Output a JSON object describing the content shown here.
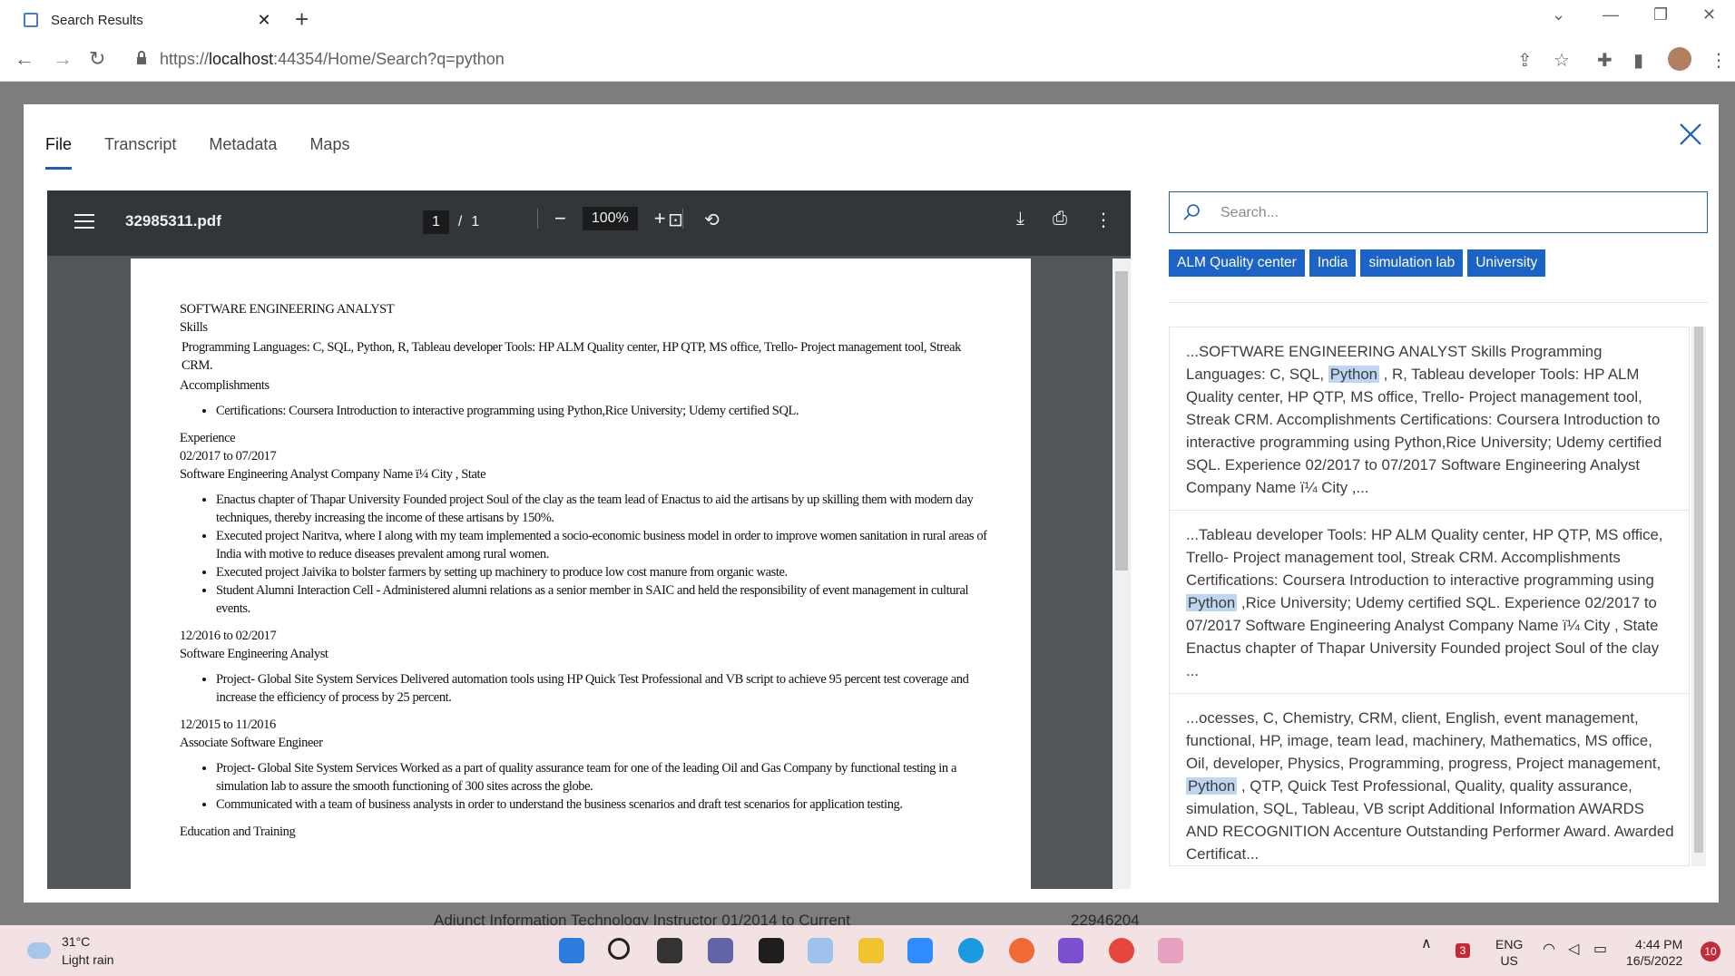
{
  "browser": {
    "tab_title": "Search Results",
    "url_prefix": "https://",
    "url_host": "localhost",
    "url_rest": ":44354/Home/Search?q=python"
  },
  "background_page": {
    "text_left": "Adjunct Information Technology Instructor 01/2014 to Current",
    "text_right": "22946204"
  },
  "modal": {
    "tabs": [
      "File",
      "Transcript",
      "Metadata",
      "Maps"
    ],
    "active_tab": "File"
  },
  "pdf": {
    "filename": "32985311.pdf",
    "current_page": "1",
    "page_sep": "/",
    "total_pages": "1",
    "zoom": "100%",
    "lines": {
      "title": "SOFTWARE ENGINEERING ANALYST",
      "skills": "Skills",
      "skills_text": "Programming Languages: C, SQL, Python, R, Tableau developer Tools: HP ALM Quality center, HP QTP, MS office, Trello- Project management tool, Streak CRM.",
      "accomplishments": "Accomplishments",
      "cert": "Certifications: Coursera Introduction to interactive programming using Python,Rice University; Udemy certified SQL.",
      "experience": "Experience",
      "date1": "02/2017 to 07/2017",
      "role1": "Software Engineering Analyst Company Name ï¼ City , State",
      "b1": "Enactus chapter of Thapar University Founded project Soul of the clay as the team lead of Enactus to aid the artisans by up skilling them with modern day techniques, thereby increasing the income of these artisans by 150%.",
      "b2": "Executed project Naritva, where I along with my team implemented a socio-economic business model in order to improve women sanitation in rural areas of India with motive to reduce diseases prevalent among rural women.",
      "b3": "Executed project Jaivika to bolster farmers by setting up machinery to produce low cost manure from organic waste.",
      "b4": "Student Alumni Interaction Cell - Administered alumni relations as a senior member in SAIC and held the responsibility of event management in cultural events.",
      "date2": "12/2016 to 02/2017",
      "role2": "Software Engineering Analyst",
      "b5": "Project- Global Site System Services Delivered automation tools using HP Quick Test Professional and VB script to achieve 95 percent test coverage and increase the efficiency of process by 25 percent.",
      "date3": "12/2015 to 11/2016",
      "role3": "Associate Software Engineer",
      "b6": "Project- Global Site System Services Worked as a part of quality assurance team for one of the leading Oil and Gas Company by functional testing in a simulation lab to assure the smooth functioning of 300 sites across the globe.",
      "b7": "Communicated with a team of business analysts in order to understand the business scenarios and draft test scenarios for application testing.",
      "edu": "Education and Training"
    }
  },
  "search": {
    "placeholder": "Search..."
  },
  "tags": [
    "ALM Quality center",
    "India",
    "simulation lab",
    "University"
  ],
  "results": [
    {
      "before": "...SOFTWARE ENGINEERING ANALYST Skills Programming Languages: C, SQL, ",
      "highlight": "Python",
      "after": " , R, Tableau developer Tools: HP ALM Quality center, HP QTP, MS office, Trello- Project management tool, Streak CRM. Accomplishments Certifications: Coursera Introduction to interactive programming using Python,Rice University; Udemy certified SQL. Experience 02/2017 to 07/2017 Software Engineering Analyst Company Name ï¼ City ,..."
    },
    {
      "before": "...Tableau developer Tools: HP ALM Quality center, HP QTP, MS office, Trello- Project management tool, Streak CRM. Accomplishments Certifications: Coursera Introduction to interactive programming using ",
      "highlight": "Python",
      "after": " ,Rice University; Udemy certified SQL. Experience 02/2017 to 07/2017 Software Engineering Analyst Company Name ï¼ City , State Enactus chapter of Thapar University Founded project Soul of the clay ..."
    },
    {
      "before": "...ocesses, C, Chemistry, CRM, client, English, event management, functional, HP, image, team lead, machinery, Mathematics, MS office, Oil, developer, Physics, Programming, progress, Project management, ",
      "highlight": "Python",
      "after": " , QTP, Quick Test Professional, Quality, quality assurance, simulation, SQL, Tableau, VB script Additional Information AWARDS AND RECOGNITION Accenture Outstanding Performer Award. Awarded Certificat..."
    }
  ],
  "taskbar": {
    "temperature": "31°C",
    "weather": "Light rain",
    "lang": "ENG",
    "region": "US",
    "time": "4:44 PM",
    "date": "16/5/2022",
    "notifications": "10",
    "security_badge": "3"
  },
  "colors": {
    "accent": "#1b63c6",
    "highlight": "#bfd6f2",
    "pdf_toolbar": "#323639",
    "taskbar": "#f3e2e4"
  }
}
